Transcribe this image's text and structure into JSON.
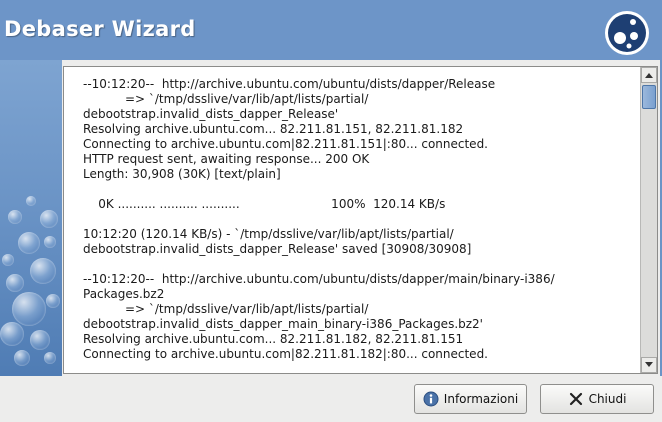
{
  "window": {
    "title": "Debaser Wizard"
  },
  "log": {
    "lines": [
      "--10:12:20--  http://archive.ubuntu.com/ubuntu/dists/dapper/Release",
      "           => `/tmp/dsslive/var/lib/apt/lists/partial/",
      "debootstrap.invalid_dists_dapper_Release'",
      "Resolving archive.ubuntu.com... 82.211.81.151, 82.211.81.182",
      "Connecting to archive.ubuntu.com|82.211.81.151|:80... connected.",
      "HTTP request sent, awaiting response... 200 OK",
      "Length: 30,908 (30K) [text/plain]",
      "",
      "    0K .......... .......... ..........                        100%  120.14 KB/s",
      "",
      "10:12:20 (120.14 KB/s) - `/tmp/dsslive/var/lib/apt/lists/partial/",
      "debootstrap.invalid_dists_dapper_Release' saved [30908/30908]",
      "",
      "--10:12:20--  http://archive.ubuntu.com/ubuntu/dists/dapper/main/binary-i386/",
      "Packages.bz2",
      "           => `/tmp/dsslive/var/lib/apt/lists/partial/",
      "debootstrap.invalid_dists_dapper_main_binary-i386_Packages.bz2'",
      "Resolving archive.ubuntu.com... 82.211.81.182, 82.211.81.151",
      "Connecting to archive.ubuntu.com|82.211.81.182|:80... connected."
    ]
  },
  "buttons": {
    "info_label": "Informazioni",
    "close_label": "Chiudi"
  },
  "icons": {
    "info": "info-icon",
    "close": "close-x-icon",
    "logo": "debaser-logo-icon"
  },
  "colors": {
    "header": "#6d95c8",
    "background": "#ededec",
    "scroll_thumb": "#7aa0cf"
  }
}
